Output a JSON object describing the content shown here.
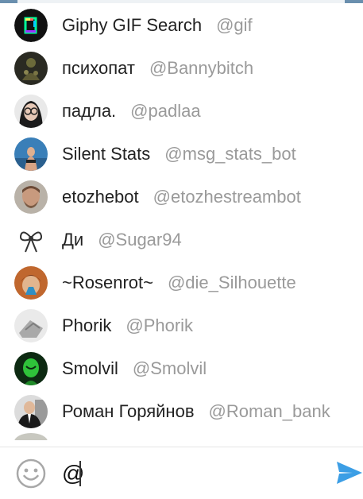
{
  "suggestions": [
    {
      "name": "Giphy GIF Search",
      "username": "@gif",
      "avatar": "giphy-logo-icon"
    },
    {
      "name": "психопат",
      "username": "@Bannybitch",
      "avatar": "user-avatar"
    },
    {
      "name": "падла.",
      "username": "@padlaa",
      "avatar": "user-avatar"
    },
    {
      "name": "Silent Stats",
      "username": "@msg_stats_bot",
      "avatar": "user-avatar"
    },
    {
      "name": "etozhebot",
      "username": "@etozhestreambot",
      "avatar": "user-avatar"
    },
    {
      "name": "Ди",
      "username": "@Sugar94",
      "avatar": "bow-icon"
    },
    {
      "name": "~Rosenrot~",
      "username": "@die_Silhouette",
      "avatar": "user-avatar"
    },
    {
      "name": "Phorik",
      "username": "@Phorik",
      "avatar": "user-avatar"
    },
    {
      "name": "Smolvil",
      "username": "@Smolvil",
      "avatar": "user-avatar"
    },
    {
      "name": "Роман Горяйнов",
      "username": "@Roman_bank",
      "avatar": "user-avatar"
    }
  ],
  "composer": {
    "value": "@",
    "emoji_icon": "smiley-icon",
    "send_icon": "send-icon"
  },
  "colors": {
    "accent": "#3c9ee5",
    "username": "#9a9a9a",
    "name": "#222222"
  }
}
